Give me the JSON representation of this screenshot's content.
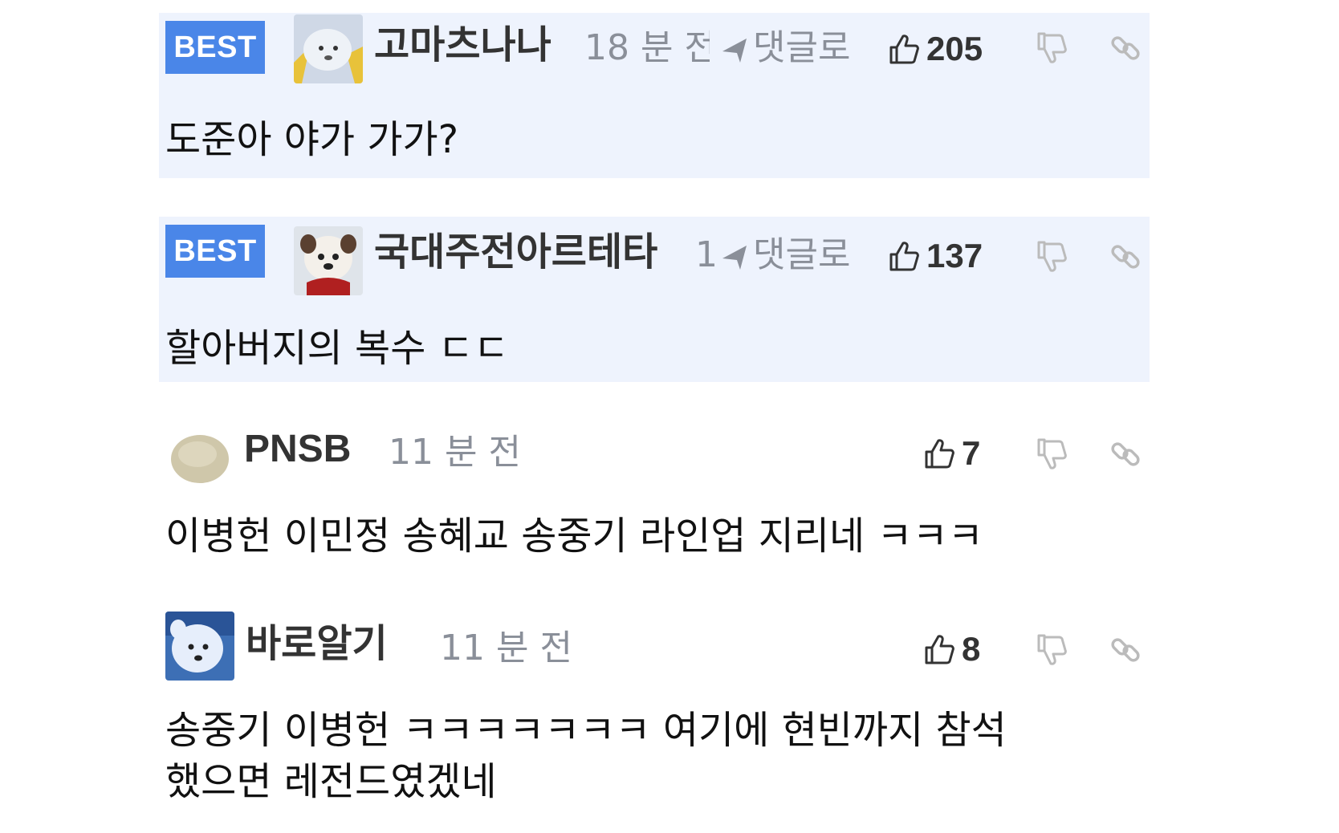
{
  "comments": [
    {
      "best_label": "BEST",
      "nickname": "고마츠나나",
      "time": "18 분 전",
      "reply_label": "댓글로",
      "likes": "205",
      "text": "도준아 야가 가가?",
      "avatar": "white-bird-avatar"
    },
    {
      "best_label": "BEST",
      "nickname": "국대주전아르테타",
      "time": "1",
      "reply_label": "댓글로",
      "likes": "137",
      "text": "할아버지의 복수 ㄷㄷ",
      "avatar": "dog-avatar"
    },
    {
      "nickname": "PNSB",
      "time": "11 분 전",
      "likes": "7",
      "text": "이병헌 이민정 송혜교 송중기 라인업 지리네 ㅋㅋㅋ",
      "avatar": "round-blob-avatar"
    },
    {
      "nickname": "바로알기",
      "time": "11 분 전",
      "likes": "8",
      "text": "송중기 이병헌 ㅋㅋㅋㅋㅋㅋㅋ 여기에 현빈까지 참석\n했으면 레전드였겠네",
      "avatar": "white-dog-avatar"
    }
  ],
  "icons": {
    "like": "thumbs-up-icon",
    "dislike": "thumbs-down-icon",
    "link": "link-icon",
    "reply": "reply-arrow-icon"
  },
  "colors": {
    "best_badge": "#4a86e8",
    "best_background": "#eef3fd",
    "meta_text": "#8a8f99"
  }
}
